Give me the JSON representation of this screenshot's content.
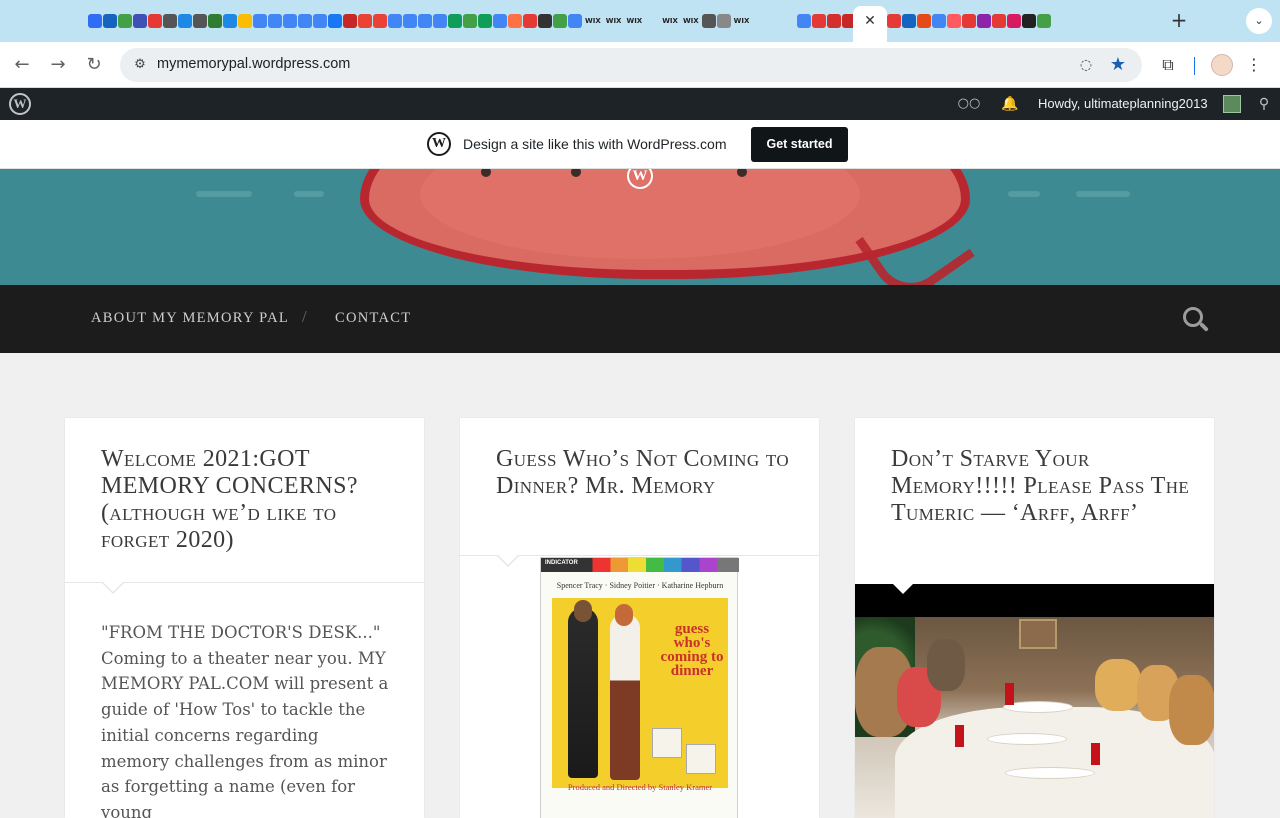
{
  "browser": {
    "url": "mymemorypal.wordpress.com",
    "close_tab_glyph": "✕",
    "new_tab_glyph": "+",
    "tab_menu_glyph": "⌄",
    "back_glyph": "←",
    "forward_glyph": "→",
    "reload_glyph": "↻",
    "site_info_glyph": "⚙",
    "eye_glyph": "◌",
    "star_glyph": "★",
    "extensions_glyph": "⧉",
    "menu_glyph": "⋮",
    "wix_labels": [
      "WIX",
      "WIX",
      "WIX",
      "WIX",
      "WIX",
      "WIX"
    ],
    "tab_icon_colors": [
      "#2f6df6",
      "#1565c0",
      "#43a047",
      "#3f51b5",
      "#e53935",
      "#555555",
      "#1e88e5",
      "#555555",
      "#2e7d32",
      "#1e88e5",
      "#fbbc04",
      "#4285f4",
      "#4285f4",
      "#4285f4",
      "#4285f4",
      "#4285f4",
      "#1877f2",
      "#c62828",
      "#ea4335",
      "#ea4335",
      "#4285f4",
      "#4285f4",
      "#4285f4",
      "#4285f4",
      "#0f9d58",
      "#43a047",
      "#0f9d58",
      "#4285f4",
      "#ff7043",
      "#e53935",
      "#333333",
      "#43a047",
      "#4285f4"
    ],
    "tab_icon_colors_2": [
      "#555555",
      "#888888"
    ],
    "tab_icon_colors_3": [
      "#4285f4",
      "#e53935",
      "#d32f2f",
      "#c62828",
      "#1e88e5",
      "#1976d2",
      "#e53935",
      "#1565c0",
      "#e64a19",
      "#4285f4",
      "#ff5a5f",
      "#e53935",
      "#8e24aa",
      "#e53935",
      "#d81b60",
      "#222222",
      "#43a047"
    ]
  },
  "admin_bar": {
    "wp_logo": "W",
    "reader_glyph": "○○",
    "bell_glyph": "🔔",
    "howdy": "Howdy, ultimateplanning2013",
    "search_glyph": "⚲"
  },
  "banner": {
    "logo": "W",
    "text": "Design a site like this with WordPress.com",
    "cta": "Get started"
  },
  "header": {
    "logo": "W",
    "colors": {
      "background": "#3e8a92",
      "blob": "#d96b62",
      "outline": "#b8262f"
    }
  },
  "nav": {
    "items": [
      {
        "label": "ABOUT MY MEMORY PAL"
      },
      {
        "label": "CONTACT"
      }
    ],
    "separator": "/"
  },
  "posts": [
    {
      "title": "Welcome 2021:GOT MEMORY CONCERNS? (although we’d like to forget 2020)",
      "excerpt": "\"FROM THE DOCTOR'S DESK...\" Coming to a theater near you. MY MEMORY PAL.COM will present a guide of 'How Tos' to tackle the initial concerns regarding memory challenges from as minor as forgetting a name (even for young"
    },
    {
      "title": "Guess Who’s Not Coming to Dinner? Mr. Memory",
      "image": {
        "kind": "movie-poster",
        "strip_label": "INDICATOR",
        "cast": "Spencer Tracy · Sidney Poitier · Katharine Hepburn",
        "title": "guess who's coming to dinner",
        "credit": "Produced and Directed by Stanley Kramer"
      }
    },
    {
      "title": "Don’t Starve Your Memory!!!!! Please Pass The Tumeric — ‘Arff, Arff’",
      "image": {
        "kind": "photo-dogs-dinner-table"
      }
    }
  ]
}
